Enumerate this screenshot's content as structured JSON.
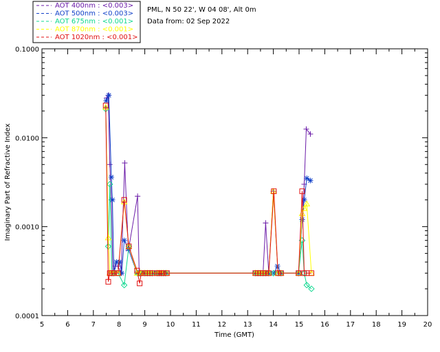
{
  "header": {
    "site_line": "PML, N 50 22', W 04 08', Alt 0m",
    "date_line": "Data from: 02 Sep 2022"
  },
  "chart_data": {
    "type": "line",
    "title": "",
    "xlabel": "Time (GMT)",
    "ylabel": "Imaginary Part of Refractive Index",
    "xlim": [
      5,
      20
    ],
    "ylim": [
      0.0001,
      0.1
    ],
    "y_scale": "log",
    "x_ticks": [
      "5",
      "6",
      "7",
      "8",
      "9",
      "10",
      "11",
      "12",
      "13",
      "14",
      "15",
      "16",
      "17",
      "18",
      "19",
      "20"
    ],
    "y_ticks": [
      "0.0001",
      "0.0010",
      "0.0100",
      "0.1000"
    ],
    "legend_position": "top-left, outside plot",
    "series": [
      {
        "name": "AOT  400nm : <0.003>",
        "color": "#6a1aa8",
        "marker": "plus",
        "x": [
          7.52,
          7.58,
          7.64,
          7.7,
          7.76,
          7.85,
          7.96,
          8.08,
          8.22,
          8.36,
          8.72,
          8.78,
          8.86,
          9.0,
          9.1,
          9.2,
          9.3,
          9.48,
          9.56,
          9.64,
          9.72,
          9.86,
          13.3,
          13.4,
          13.5,
          13.6,
          13.7,
          13.82,
          14.0,
          14.18,
          14.3,
          14.98,
          15.12,
          15.2,
          15.28,
          15.44
        ],
        "y": [
          0.028,
          0.03,
          0.005,
          0.002,
          0.0003,
          0.00036,
          0.00036,
          0.0003,
          0.0052,
          0.00054,
          0.0022,
          0.0003,
          0.0003,
          0.0003,
          0.0003,
          0.0003,
          0.0003,
          0.0003,
          0.0003,
          0.0003,
          0.0003,
          0.0003,
          0.0003,
          0.0003,
          0.0003,
          0.0003,
          0.0011,
          0.0003,
          0.0025,
          0.0003,
          0.0003,
          0.0003,
          0.0012,
          0.003,
          0.0125,
          0.011
        ]
      },
      {
        "name": "AOT  500nm : <0.003>",
        "color": "#1040c8",
        "marker": "asterisk",
        "x": [
          7.5,
          7.6,
          7.7,
          7.74,
          7.8,
          7.9,
          8.02,
          8.1,
          8.2,
          8.36,
          8.7,
          8.76,
          8.86,
          9.0,
          9.1,
          9.2,
          9.3,
          9.48,
          9.56,
          9.64,
          9.72,
          9.86,
          13.3,
          13.4,
          13.5,
          13.6,
          13.7,
          13.84,
          14.02,
          14.16,
          14.3,
          14.98,
          15.12,
          15.2,
          15.3,
          15.44
        ],
        "y": [
          0.026,
          0.03,
          0.0036,
          0.002,
          0.0003,
          0.0004,
          0.0004,
          0.0003,
          0.0007,
          0.00056,
          0.0003,
          0.0003,
          0.0003,
          0.0003,
          0.0003,
          0.0003,
          0.0003,
          0.0003,
          0.0003,
          0.0003,
          0.0003,
          0.0003,
          0.0003,
          0.0003,
          0.0003,
          0.0003,
          0.0003,
          0.0003,
          0.0003,
          0.00036,
          0.0003,
          0.0003,
          0.0012,
          0.002,
          0.0035,
          0.0033
        ]
      },
      {
        "name": "AOT  675nm : <0.001>",
        "color": "#10d890",
        "marker": "diamond",
        "x": [
          7.48,
          7.58,
          7.64,
          7.72,
          7.8,
          7.96,
          8.2,
          8.38,
          8.72,
          8.78,
          8.8,
          8.84,
          8.86,
          9.0,
          9.1,
          9.2,
          9.3,
          9.48,
          9.56,
          9.64,
          9.72,
          9.8,
          13.3,
          13.4,
          13.5,
          13.6,
          13.7,
          13.82,
          14.0,
          14.18,
          14.3,
          14.98,
          15.12,
          15.2,
          15.3,
          15.48
        ],
        "y": [
          0.021,
          0.0006,
          0.003,
          0.0003,
          0.0003,
          0.0003,
          0.00022,
          0.0006,
          0.0003,
          0.0003,
          0.0003,
          0.0003,
          0.0003,
          0.0003,
          0.0003,
          0.0003,
          0.0003,
          0.0003,
          0.0003,
          0.0003,
          0.0003,
          0.0003,
          0.0003,
          0.0003,
          0.0003,
          0.0003,
          0.0003,
          0.0003,
          0.0003,
          0.0003,
          0.0003,
          0.0003,
          0.0007,
          0.0003,
          0.00022,
          0.0002
        ]
      },
      {
        "name": "AOT  870nm : <0.001>",
        "color": "#ffff00",
        "marker": "triangle",
        "x": [
          7.48,
          7.58,
          7.64,
          7.72,
          7.8,
          7.96,
          8.2,
          8.38,
          8.7,
          8.8,
          8.86,
          9.0,
          9.1,
          9.2,
          9.3,
          9.48,
          9.56,
          9.64,
          9.72,
          9.86,
          13.3,
          13.4,
          13.5,
          13.6,
          13.7,
          13.82,
          14.0,
          14.18,
          14.3,
          14.98,
          15.12,
          15.2,
          15.3,
          15.48
        ],
        "y": [
          0.022,
          0.00075,
          0.0003,
          0.0003,
          0.0003,
          0.0003,
          0.0019,
          0.0006,
          0.0003,
          0.0003,
          0.0003,
          0.0003,
          0.0003,
          0.0003,
          0.0003,
          0.0003,
          0.0003,
          0.0003,
          0.0003,
          0.0003,
          0.0003,
          0.0003,
          0.0003,
          0.0003,
          0.0003,
          0.0003,
          0.0025,
          0.0003,
          0.0003,
          0.0003,
          0.0014,
          0.0016,
          0.0018,
          0.0003
        ]
      },
      {
        "name": "AOT 1020nm : <0.001>",
        "color": "#e01010",
        "marker": "square",
        "x": [
          7.48,
          7.58,
          7.64,
          7.72,
          7.8,
          7.96,
          8.2,
          8.38,
          8.7,
          8.8,
          8.86,
          9.0,
          9.1,
          9.2,
          9.3,
          9.48,
          9.56,
          9.64,
          9.72,
          9.86,
          13.3,
          13.4,
          13.5,
          13.6,
          13.7,
          13.82,
          14.02,
          14.18,
          14.3,
          14.98,
          15.12,
          15.2,
          15.3,
          15.48
        ],
        "y": [
          0.023,
          0.00024,
          0.0003,
          0.0003,
          0.0003,
          0.0003,
          0.002,
          0.0006,
          0.00032,
          0.00023,
          0.0003,
          0.0003,
          0.0003,
          0.0003,
          0.0003,
          0.0003,
          0.0003,
          0.0003,
          0.0003,
          0.0003,
          0.0003,
          0.0003,
          0.0003,
          0.0003,
          0.0003,
          0.0003,
          0.0025,
          0.0003,
          0.0003,
          0.0003,
          0.0025,
          0.0003,
          0.0003,
          0.0003
        ]
      }
    ]
  }
}
